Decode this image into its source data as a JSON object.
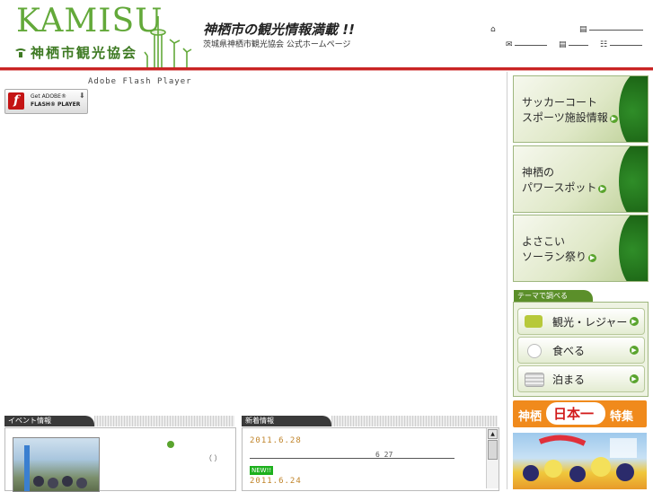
{
  "header": {
    "logo_word": "KAMISU",
    "logo_sub": "神栖市観光協会",
    "tagline": "神栖市の観光情報満載 !!",
    "subtag": "茨城県神栖市観光協会 公式ホームページ"
  },
  "flash": {
    "player_text": "Adobe Flash Player",
    "button_line1": "Get ADOBE®",
    "button_line2": "FLASH® PLAYER",
    "logo_letter": "f"
  },
  "sidebar": {
    "banners": [
      {
        "line1": "サッカーコート",
        "line2": "スポーツ施設情報"
      },
      {
        "line1": "神栖の",
        "line2": "パワースポット"
      },
      {
        "line1": "よさこい",
        "line2": "ソーラン祭り"
      }
    ],
    "theme_label": "テーマで調べる",
    "theme_items": [
      {
        "label": "観光・レジャー",
        "icon": "bus-icon"
      },
      {
        "label": "食べる",
        "icon": "plate-icon"
      },
      {
        "label": "泊まる",
        "icon": "bed-icon"
      }
    ],
    "nippon": {
      "left": "神栖",
      "center": "日本一",
      "right": "特集"
    }
  },
  "events": {
    "tab_label": "イベント情報",
    "paren": "（ ）"
  },
  "news": {
    "tab_label": "新着情報",
    "items": [
      {
        "date": "2011.6.28",
        "note": "6 27"
      },
      {
        "badge": "NEW!!",
        "date": "2011.6.24"
      }
    ]
  },
  "colors": {
    "brand_green": "#63a93a",
    "rule_red": "#c92424",
    "accent_green": "#5aa42e",
    "nippon_orange": "#f08a1c"
  }
}
